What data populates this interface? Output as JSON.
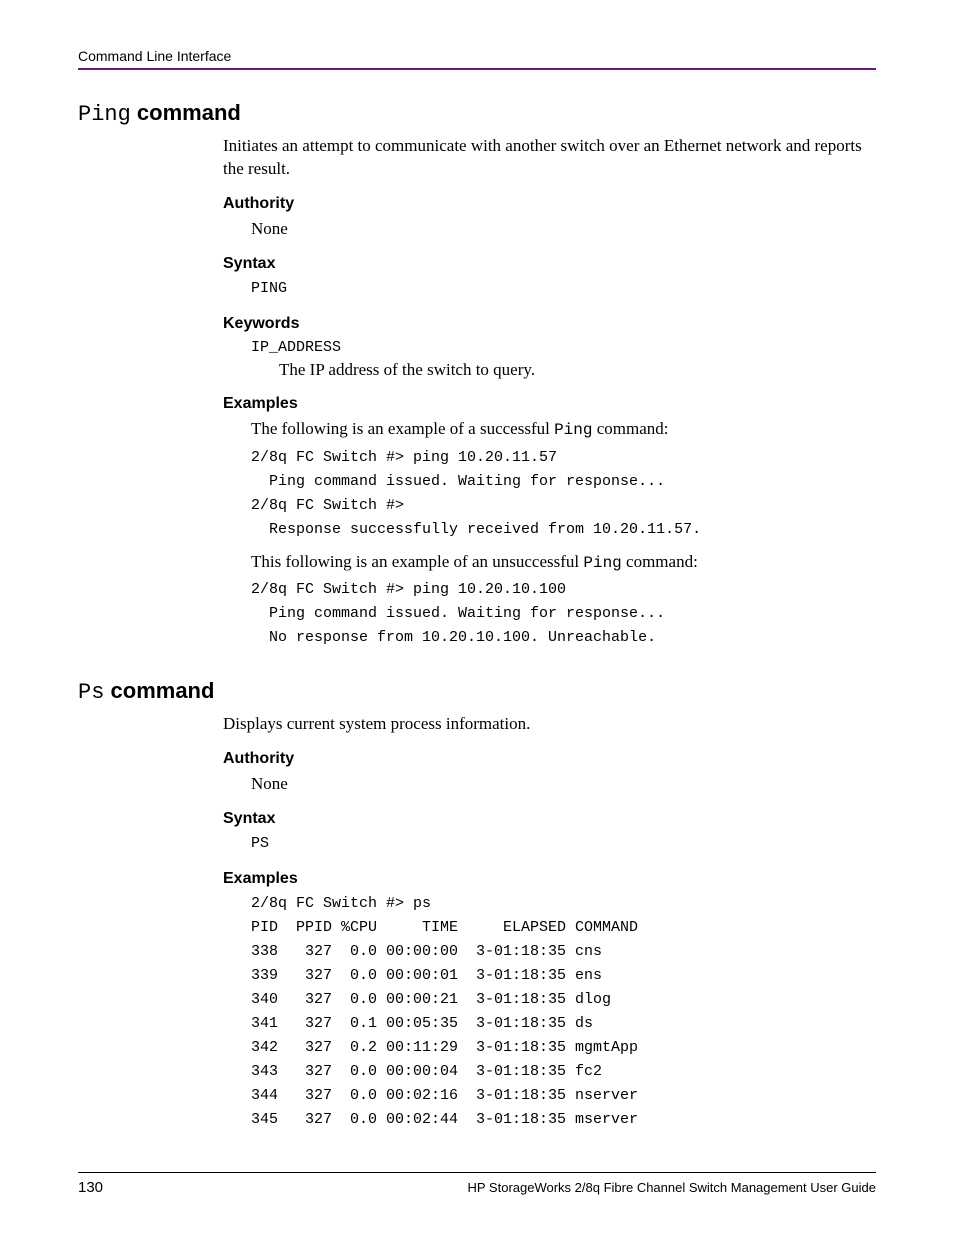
{
  "header": {
    "running_title": "Command Line Interface"
  },
  "sections": [
    {
      "title_mono": "Ping",
      "title_bold": " command",
      "intro": "Initiates an attempt to communicate with another switch over an Ethernet network and reports the result.",
      "authority_label": "Authority",
      "authority_value": "None",
      "syntax_label": "Syntax",
      "syntax_value": "PING",
      "keywords_label": "Keywords",
      "keyword_term": "IP_ADDRESS",
      "keyword_desc": "The IP address of the switch to query.",
      "examples_label": "Examples",
      "example_intro_1a": "The following is an example of a successful ",
      "example_intro_1b": "Ping",
      "example_intro_1c": " command:",
      "example_code_1": "2/8q FC Switch #> ping 10.20.11.57\n  Ping command issued. Waiting for response...\n2/8q FC Switch #>\n  Response successfully received from 10.20.11.57.",
      "example_intro_2a": "This following is an example of an unsuccessful ",
      "example_intro_2b": "Ping",
      "example_intro_2c": " command:",
      "example_code_2": "2/8q FC Switch #> ping 10.20.10.100\n  Ping command issued. Waiting for response...\n  No response from 10.20.10.100. Unreachable."
    },
    {
      "title_mono": "Ps",
      "title_bold": " command",
      "intro": "Displays current system process information.",
      "authority_label": "Authority",
      "authority_value": "None",
      "syntax_label": "Syntax",
      "syntax_value": "PS",
      "examples_label": "Examples",
      "example_code_1": "2/8q FC Switch #> ps\nPID  PPID %CPU     TIME     ELAPSED COMMAND\n338   327  0.0 00:00:00  3-01:18:35 cns\n339   327  0.0 00:00:01  3-01:18:35 ens\n340   327  0.0 00:00:21  3-01:18:35 dlog\n341   327  0.1 00:05:35  3-01:18:35 ds\n342   327  0.2 00:11:29  3-01:18:35 mgmtApp\n343   327  0.0 00:00:04  3-01:18:35 fc2\n344   327  0.0 00:02:16  3-01:18:35 nserver\n345   327  0.0 00:02:44  3-01:18:35 mserver"
    }
  ],
  "footer": {
    "page_number": "130",
    "guide_title": "HP StorageWorks 2/8q Fibre Channel Switch Management User Guide"
  }
}
